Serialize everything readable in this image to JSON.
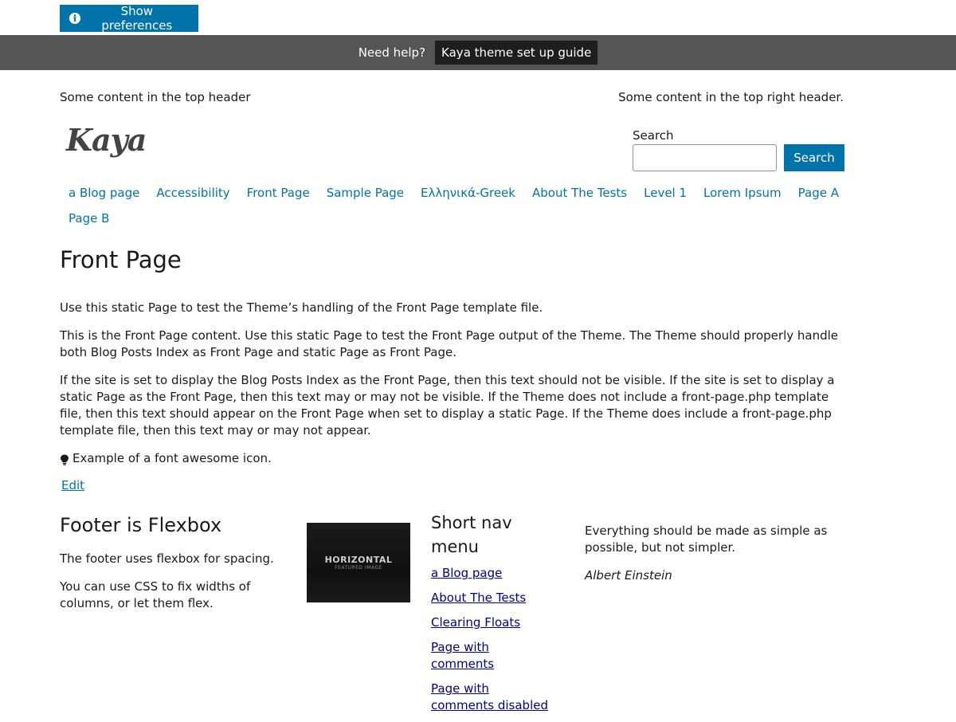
{
  "preferences": {
    "label": "Show preferences"
  },
  "helpbar": {
    "label": "Need help?",
    "guide_link": "Kaya theme set up guide"
  },
  "header": {
    "top_left": "Some content in the top header",
    "top_right": "Some content in the top right header.",
    "logo": "Kaya",
    "search": {
      "label": "Search",
      "value": "",
      "button": "Search"
    }
  },
  "nav": {
    "items": [
      "a Blog page",
      "Accessibility",
      "Front Page",
      "Sample Page",
      "Ελληνικά-Greek",
      "About The Tests",
      "Level 1",
      "Lorem Ipsum",
      "Page A",
      "Page B"
    ]
  },
  "main": {
    "title": "Front Page",
    "p1": "Use this static Page to test the Theme’s handling of the Front Page template file.",
    "p2": "This is the Front Page content. Use this static Page to test the Front Page output of the Theme. The Theme should properly handle both Blog Posts Index as Front Page and static Page as Front Page.",
    "p3": "If the site is set to display the Blog Posts Index as the Front Page, then this text should not be visible. If the site is set to display a static Page as the Front Page, then this text may or may not be visible. If the Theme does not include a front-page.php template file, then this text should appear on the Front Page when set to display a static Page. If the Theme does include a front-page.php template file, then this text may or may not appear.",
    "icon_text": "Example of a font awesome icon.",
    "edit": "Edit"
  },
  "footer": {
    "col1": {
      "title": "Footer is Flexbox",
      "p1": "The footer uses flexbox for spacing.",
      "p2": "You can use CSS to fix widths of columns, or let them flex."
    },
    "image": {
      "title": "HORIZONTAL",
      "subtitle": "FEATURED IMAGE"
    },
    "col3": {
      "title": "Short nav menu",
      "items": [
        "a Blog page",
        "About The Tests",
        "Clearing Floats",
        "Page with comments",
        "Page with comments disabled"
      ]
    },
    "col4": {
      "quote": "Everything should be made as simple as possible, but not simpler.",
      "cite": "Albert Einstein"
    }
  }
}
